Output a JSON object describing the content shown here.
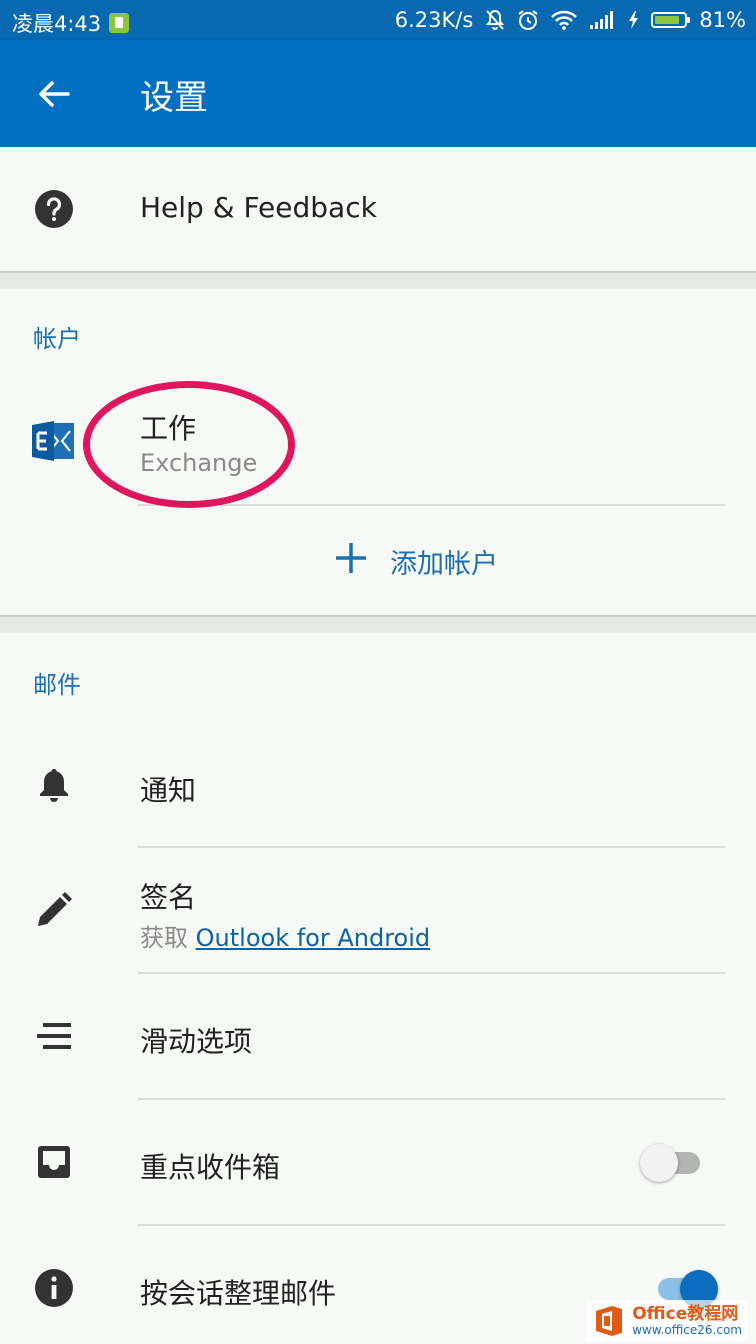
{
  "status_bar": {
    "time": "凌晨4:43",
    "network_speed": "6.23K/s",
    "battery_percent": "81%",
    "icons": [
      "sim-icon",
      "mute-icon",
      "alarm-icon",
      "wifi-icon",
      "signal-icon",
      "charging-icon",
      "battery-icon"
    ]
  },
  "app_bar": {
    "back_icon": "back-arrow-icon",
    "title": "设置"
  },
  "help": {
    "icon": "help-circle-icon",
    "label": "Help & Feedback"
  },
  "accounts": {
    "header": "帐户",
    "items": [
      {
        "icon": "exchange-icon",
        "name": "工作",
        "type": "Exchange"
      }
    ],
    "add_label": "添加帐户",
    "add_icon": "plus-icon"
  },
  "mail": {
    "header": "邮件",
    "items": [
      {
        "icon": "bell-icon",
        "label": "通知"
      },
      {
        "icon": "pencil-icon",
        "label": "签名",
        "sub_prefix": "获取",
        "sub_link": "Outlook for Android"
      },
      {
        "icon": "swipe-options-icon",
        "label": "滑动选项"
      },
      {
        "icon": "inbox-icon",
        "label": "重点收件箱",
        "toggle": false
      },
      {
        "icon": "info-icon",
        "label": "按会话整理邮件",
        "toggle": true
      }
    ]
  },
  "colors": {
    "brand": "#0070c0",
    "accent_text": "#1d6fb2",
    "highlight_oval": "#e0155d"
  },
  "watermark": {
    "line1": "Office教程网",
    "line2": "www.office26.com"
  }
}
